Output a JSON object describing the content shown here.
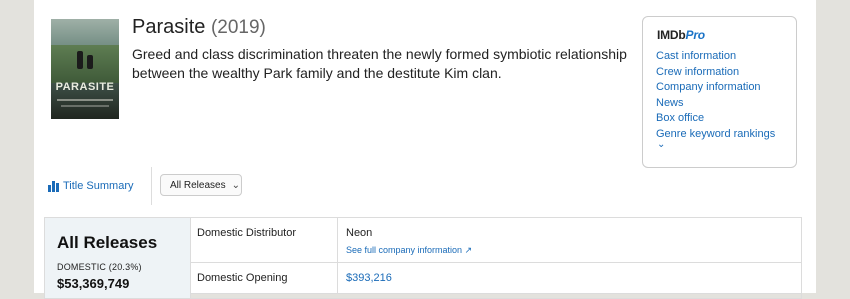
{
  "title": {
    "name": "Parasite",
    "year": "(2019)",
    "summary": "Greed and class discrimination threaten the newly formed symbiotic relationship between the wealthy Park family and the destitute Kim clan."
  },
  "poster": {
    "title_text": "PARASITE"
  },
  "imdbpro": {
    "logo_main": "IMDb",
    "logo_pro": "Pro",
    "links": [
      "Cast information",
      "Crew information",
      "Company information",
      "News",
      "Box office",
      "Genre keyword rankings"
    ],
    "more_glyph": "⌄"
  },
  "tabs": {
    "active_label": "Title Summary",
    "select_value": "All Releases"
  },
  "releases": {
    "heading": "All Releases",
    "domestic_label": "DOMESTIC (20.3%)",
    "domestic_value": "$53,369,749",
    "rows": [
      {
        "key": "Domestic Distributor",
        "value": "Neon",
        "sub": "See full company information"
      },
      {
        "key": "Domestic Opening",
        "value": "$393,216"
      }
    ]
  },
  "colors": {
    "link": "#1a6bb8",
    "panel": "#eef3f6",
    "background": "#e3e2dd"
  }
}
